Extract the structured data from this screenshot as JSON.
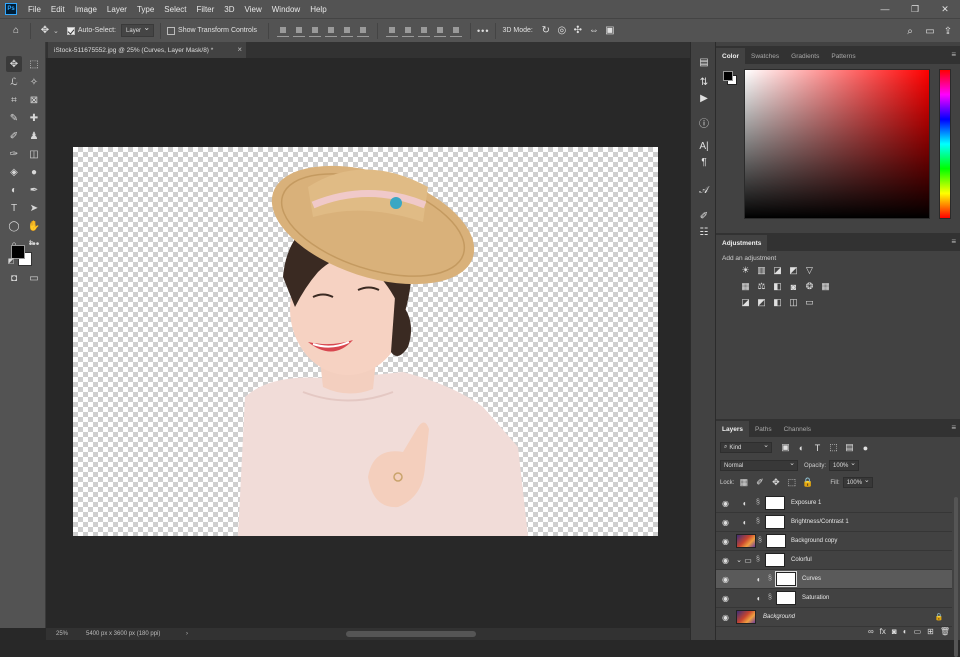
{
  "menubar": {
    "logo": "Ps",
    "items": [
      "File",
      "Edit",
      "Image",
      "Layer",
      "Type",
      "Select",
      "Filter",
      "3D",
      "View",
      "Window",
      "Help"
    ],
    "window_controls": [
      "—",
      "❐",
      "✕"
    ]
  },
  "options": {
    "auto_select_label": "Auto-Select:",
    "auto_select_value": "Layer",
    "transform_label": "Show Transform Controls",
    "mode_3d_label": "3D Mode:",
    "more": "•••"
  },
  "document_tab": {
    "title": "iStock-511675552.jpg @ 25% (Curves, Layer Mask/8) *",
    "close": "×"
  },
  "status": {
    "zoom": "25%",
    "info": "5400 px x 3600 px (180 ppi)",
    "arrow": "›"
  },
  "color_panel": {
    "tabs": [
      "Color",
      "Swatches",
      "Gradients",
      "Patterns"
    ],
    "active_tab": "Color"
  },
  "adjustments_panel": {
    "title": "Adjustments",
    "add_label": "Add an adjustment"
  },
  "layers_panel": {
    "tabs": [
      "Layers",
      "Paths",
      "Channels"
    ],
    "kind_label": "Kind",
    "blend_mode": "Normal",
    "opacity_label": "Opacity:",
    "opacity_value": "100%",
    "lock_label": "Lock:",
    "fill_label": "Fill:",
    "fill_value": "100%",
    "layers": [
      {
        "name": "Exposure 1",
        "type": "adjustment"
      },
      {
        "name": "Brightness/Contrast 1",
        "type": "adjustment"
      },
      {
        "name": "Background copy",
        "type": "image"
      },
      {
        "name": "Colorful",
        "type": "group"
      },
      {
        "name": "Curves",
        "type": "adjustment",
        "selected": true
      },
      {
        "name": "Saturation",
        "type": "adjustment"
      },
      {
        "name": "Background",
        "type": "image"
      }
    ],
    "footer_icons": [
      "link-icon",
      "fx-icon",
      "mask-icon",
      "adjustment-icon",
      "group-icon",
      "new-layer-icon",
      "trash-icon"
    ]
  },
  "colors": {
    "foreground": "#000000",
    "background": "#ffffff",
    "accent": "#31a8ff"
  }
}
